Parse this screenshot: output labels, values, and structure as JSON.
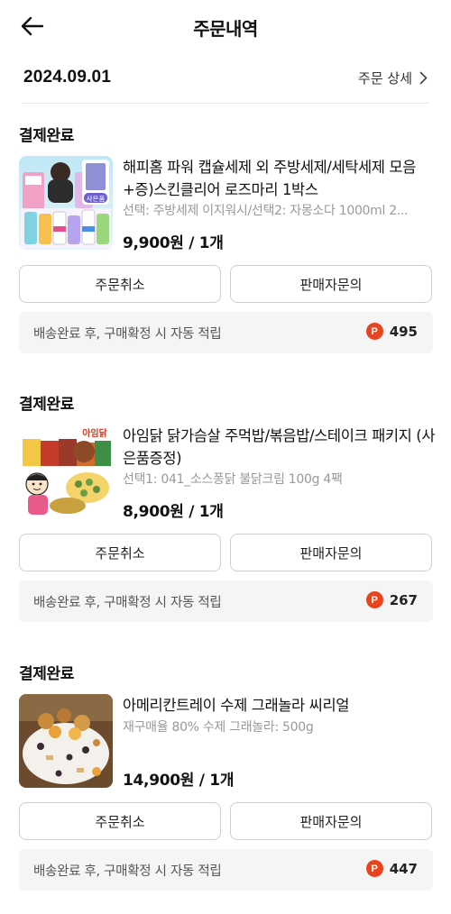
{
  "header": {
    "title": "주문내역",
    "back_icon": "arrow-left-icon"
  },
  "order_group": {
    "date": "2024.09.01",
    "detail_label": "주문 상세",
    "detail_icon": "chevron-right-icon"
  },
  "orders": [
    {
      "status": "결제완료",
      "product_name": "해피홈 파워 캡슐세제 외 주방세제/세탁세제 모음 +증)스킨클리어 로즈마리 1박스",
      "option": "선택: 주방세제 이지워시/선택2: 자몽소다 1000ml 2...",
      "price": "9,900원 / 1개",
      "gift_badge": "사은품",
      "cancel_label": "주문취소",
      "inquiry_label": "판매자문의",
      "point_text": "배송완료 후, 구매확정 시 자동 적립",
      "point_badge": "P",
      "points": "495"
    },
    {
      "status": "결제완료",
      "product_name": "아임닭 닭가슴살 주먹밥/볶음밥/스테이크 패키지 (사은품증정)",
      "option": "선택1: 041_소스퐁닭 불닭크림 100g 4팩",
      "price": "8,900원 / 1개",
      "brand_mark": "아임닭",
      "cancel_label": "주문취소",
      "inquiry_label": "판매자문의",
      "point_text": "배송완료 후, 구매확정 시 자동 적립",
      "point_badge": "P",
      "points": "267"
    },
    {
      "status": "결제완료",
      "product_name": "아메리칸트레이 수제 그래놀라 씨리얼",
      "option": "재구매율 80% 수제 그래놀라: 500g",
      "price": "14,900원 / 1개",
      "cancel_label": "주문취소",
      "inquiry_label": "판매자문의",
      "point_text": "배송완료 후, 구매확정 시 자동 적립",
      "point_badge": "P",
      "points": "447"
    }
  ],
  "colors": {
    "point_badge": "#e8441f",
    "point_box_bg": "#f5f5f5",
    "button_border": "#cfcfcf",
    "option_text": "#999999"
  }
}
